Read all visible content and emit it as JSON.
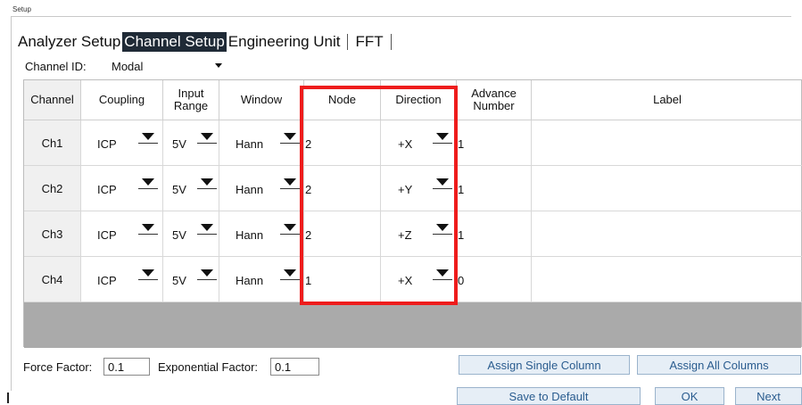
{
  "window": {
    "title": "Setup"
  },
  "tabs": [
    "Analyzer Setup",
    "Channel Setup",
    "Engineering Unit",
    "FFT"
  ],
  "channel_id": {
    "label": "Channel ID:",
    "value": "Modal"
  },
  "table": {
    "headers": {
      "channel": "Channel",
      "coupling": "Coupling",
      "range_line1": "Input",
      "range_line2": "Range",
      "window": "Window",
      "node": "Node",
      "direction": "Direction",
      "advance_line1": "Advance",
      "advance_line2": "Number",
      "label": "Label"
    },
    "rows": [
      {
        "channel": "Ch1",
        "coupling": "ICP",
        "range": "5V",
        "window": "Hann",
        "node": "2",
        "direction": "+X",
        "advance": "1",
        "label": ""
      },
      {
        "channel": "Ch2",
        "coupling": "ICP",
        "range": "5V",
        "window": "Hann",
        "node": "2",
        "direction": "+Y",
        "advance": "1",
        "label": ""
      },
      {
        "channel": "Ch3",
        "coupling": "ICP",
        "range": "5V",
        "window": "Hann",
        "node": "2",
        "direction": "+Z",
        "advance": "1",
        "label": ""
      },
      {
        "channel": "Ch4",
        "coupling": "ICP",
        "range": "5V",
        "window": "Hann",
        "node": "1",
        "direction": "+X",
        "advance": "0",
        "label": ""
      }
    ]
  },
  "footer": {
    "force_factor_label": "Force Factor:",
    "force_factor_value": "0.1",
    "exp_factor_label": "Exponential Factor:",
    "exp_factor_value": "0.1",
    "assign_single": "Assign Single Column",
    "assign_all": "Assign All Columns",
    "save_default": "Save to Default",
    "ok": "OK",
    "next": "Next"
  },
  "colors": {
    "highlight": "#ee1c1c",
    "active_tab": "#1f2a36",
    "button_text": "#2a5c8f"
  }
}
